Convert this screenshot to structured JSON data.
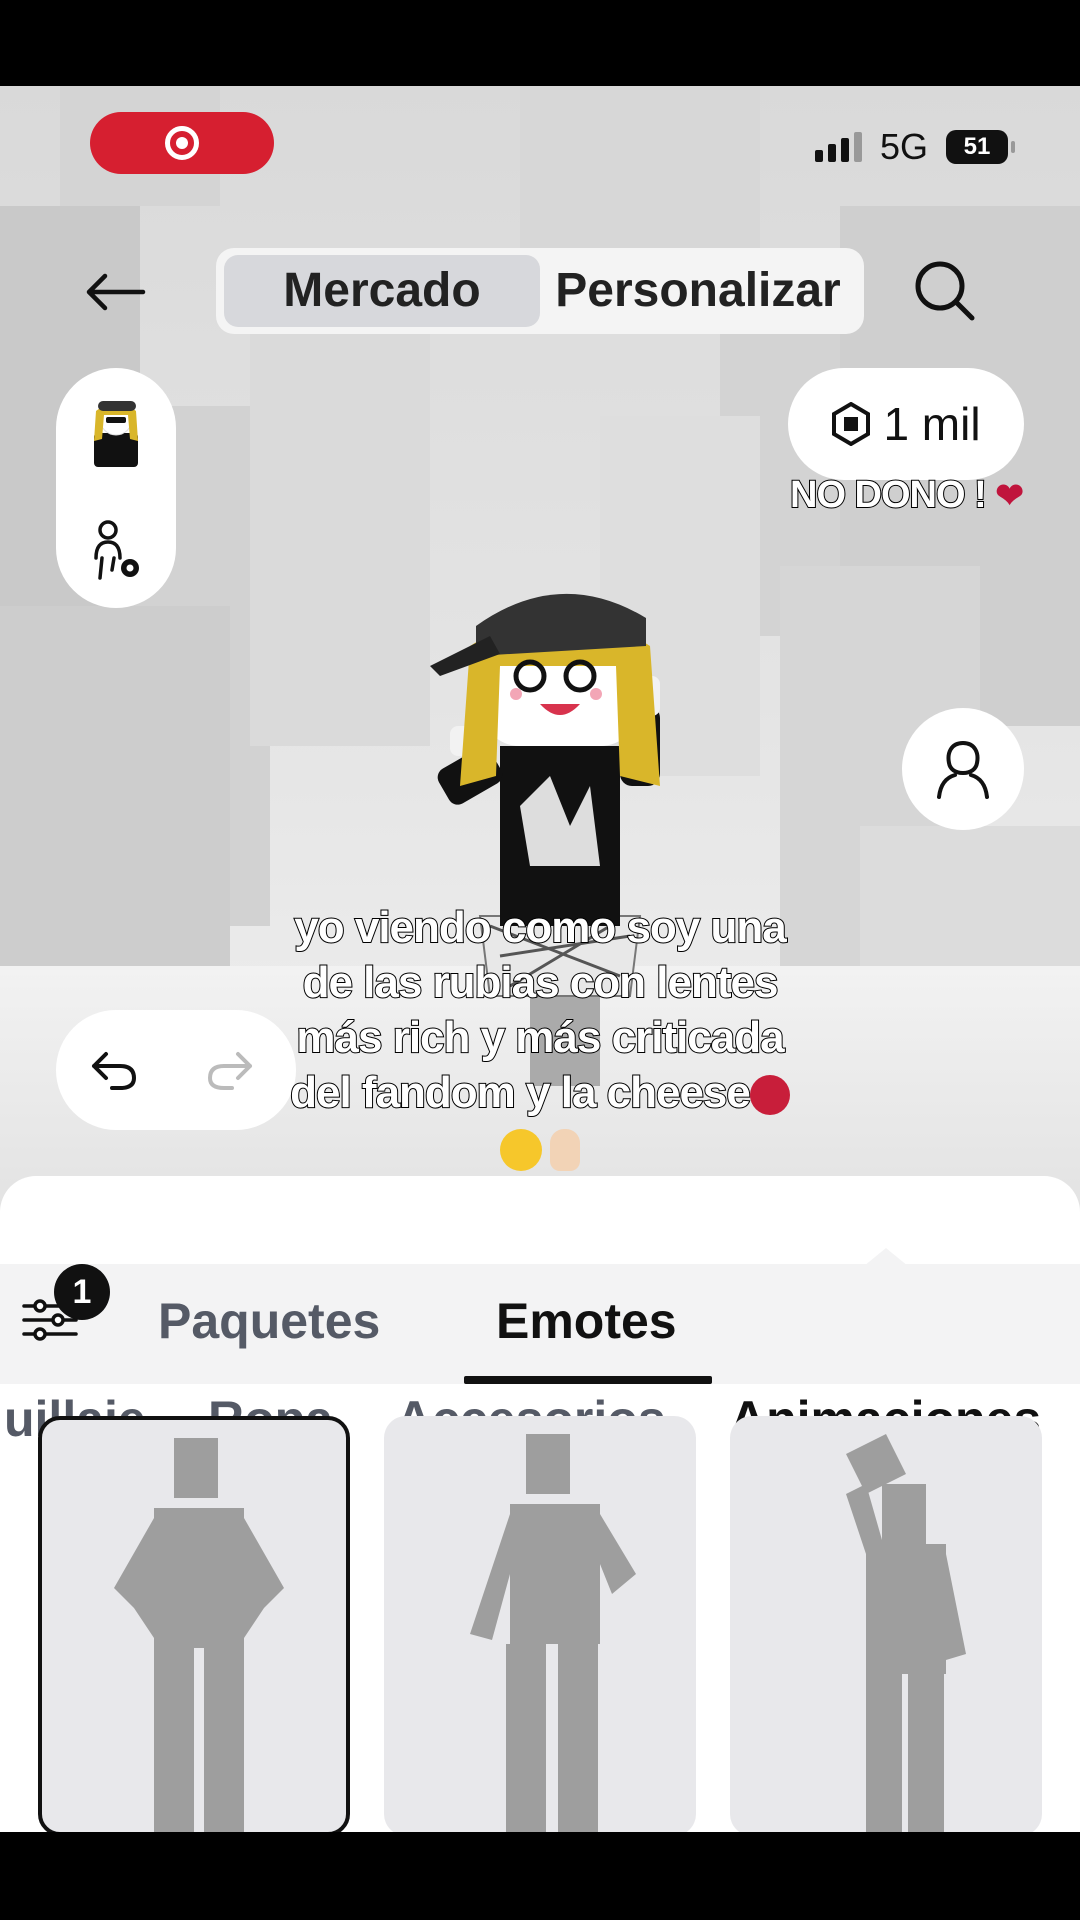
{
  "status_bar": {
    "network": "5G",
    "battery": "51"
  },
  "nav": {
    "tabs": [
      {
        "label": "Mercado",
        "active": true
      },
      {
        "label": "Personalizar",
        "active": false
      }
    ]
  },
  "robux": {
    "amount": "1 mil"
  },
  "overlay_tag": "NO DONO !",
  "caption": {
    "lines": [
      "yo viendo como soy una",
      "de las rubias con lentes",
      "más rich y más criticada",
      "del fandom y la cheese"
    ]
  },
  "categories": [
    {
      "label": "uillaje",
      "active": false
    },
    {
      "label": "Ropa",
      "active": false
    },
    {
      "label": "Accesorios",
      "active": false
    },
    {
      "label": "Animaciones",
      "active": true
    }
  ],
  "filter": {
    "badge_count": "1"
  },
  "subtabs": [
    {
      "label": "Paquetes",
      "active": false
    },
    {
      "label": "Emotes",
      "active": true
    }
  ],
  "icons": {
    "back": "arrow-left-icon",
    "search": "search-icon",
    "robux": "robux-icon",
    "profile": "person-outline-icon",
    "undo": "undo-icon",
    "redo": "redo-icon",
    "filter": "sliders-icon",
    "record": "record-icon",
    "avatar_settings": "avatar-settings-icon"
  },
  "colors": {
    "record": "#d61f30",
    "accent": "#111111",
    "card": "#e8e8eb"
  }
}
